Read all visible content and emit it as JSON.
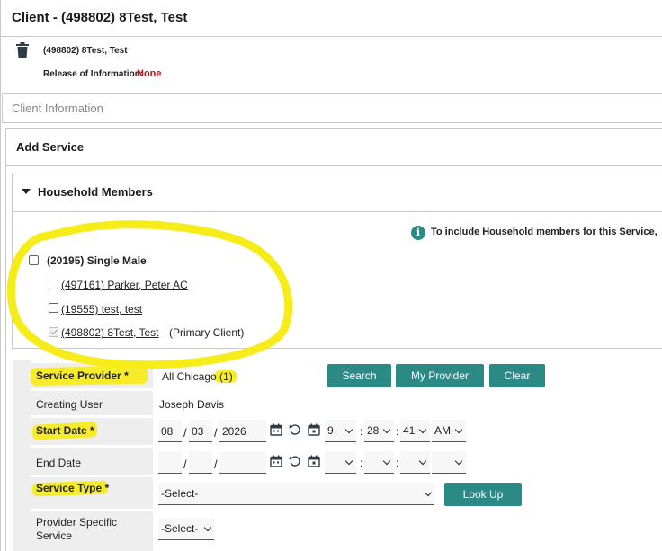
{
  "window": {
    "title": "Client - (498802) 8Test, Test"
  },
  "client_header": {
    "name": "(498802) 8Test, Test",
    "release_label": "Release of Information:",
    "release_value": "None"
  },
  "client_info_bar": {
    "label": "Client Information"
  },
  "add_service": {
    "title": "Add Service",
    "household": {
      "title": "Household Members",
      "info_text": "To include Household members for this Service,",
      "group": {
        "label": "(20195) Single Male",
        "checked": false
      },
      "members": [
        {
          "label": "(497161) Parker, Peter AC",
          "checked": false
        },
        {
          "label": "(19555) test, test",
          "checked": false
        },
        {
          "label": "(498802) 8Test, Test",
          "checked": true,
          "tag": "(Primary Client)"
        }
      ]
    },
    "form": {
      "service_provider": {
        "label": "Service Provider",
        "required": "*",
        "value": "All Chicago (1)"
      },
      "buttons": {
        "search": "Search",
        "my_provider": "My Provider",
        "clear": "Clear",
        "look_up": "Look Up"
      },
      "creating_user": {
        "label": "Creating User",
        "value": "Joseph Davis"
      },
      "start_date": {
        "label": "Start Date",
        "required": "*",
        "month": "08",
        "day": "03",
        "year": "2026",
        "hour": "9",
        "minute": "28",
        "second": "41",
        "ampm": "AM"
      },
      "end_date": {
        "label": "End Date"
      },
      "service_type": {
        "label": "Service Type",
        "required": "*",
        "selected": "-Select-"
      },
      "provider_specific": {
        "label_line1": "Provider Specific",
        "label_line2": "Service",
        "selected": "-Select-"
      }
    }
  },
  "colors": {
    "accent": "#2b8a86",
    "highlight": "#f6ec19",
    "release_none": "#b5121b"
  }
}
